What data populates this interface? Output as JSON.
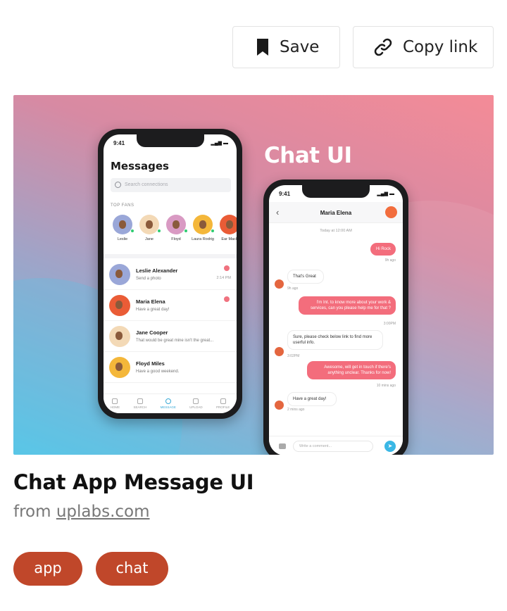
{
  "actions": {
    "save_label": "Save",
    "copy_label": "Copy link"
  },
  "hero": {
    "headline": "Chat UI",
    "messages_screen": {
      "time": "9:41",
      "title": "Messages",
      "search_placeholder": "Search connections",
      "section_label": "TOP FANS",
      "fans": [
        {
          "name": "Leslie",
          "color": "#9aa7d8"
        },
        {
          "name": "Jane",
          "color": "#f3d9b6"
        },
        {
          "name": "Floyd",
          "color": "#d99ac3"
        },
        {
          "name": "Laura Rodrig",
          "color": "#f4b73a"
        },
        {
          "name": "Ear Mack",
          "color": "#ea5c36"
        }
      ],
      "chats": [
        {
          "name": "Leslie Alexander",
          "message": "Send a photo",
          "time": "2:14 PM",
          "color": "#9aa7d8",
          "unread": true
        },
        {
          "name": "Maria Elena",
          "message": "Have a great day!",
          "time": "",
          "color": "#ea5c36",
          "unread": true
        },
        {
          "name": "Jane Cooper",
          "message": "That would be great mine isn't the great...",
          "time": "",
          "color": "#f3d9b6",
          "unread": false
        },
        {
          "name": "Floyd Miles",
          "message": "Have a good weekend.",
          "time": "",
          "color": "#f4b73a",
          "unread": false
        }
      ],
      "tabs": [
        "HOME",
        "SEARCH",
        "MESSAGE",
        "UPLOAD",
        "PROFILE"
      ]
    },
    "conversation_screen": {
      "time": "9:41",
      "contact": "Maria Elena",
      "date_label": "Today at 12:00 AM",
      "messages": [
        {
          "dir": "out",
          "text": "Hi Rock",
          "meta": "9h ago"
        },
        {
          "dir": "in",
          "text": "That's Great",
          "meta": "9h ago"
        },
        {
          "dir": "out",
          "text": "I'm Int. to know more about your work & services, can you please help me for that ?",
          "meta": "3:00PM"
        },
        {
          "dir": "in",
          "text": "Sure, please check below link to find more userful info.",
          "meta": "3:02PM"
        },
        {
          "dir": "out",
          "text": "Awesome, will get in touch if there's anything unclear. Thanks for now!",
          "meta": "10 mins ago"
        },
        {
          "dir": "in",
          "text": "Have a great day!",
          "meta": "2 mins ago"
        }
      ],
      "composer_placeholder": "Write a comment..."
    }
  },
  "pin": {
    "title": "Chat App Message UI",
    "source_prefix": "from",
    "source_domain": "uplabs.com"
  },
  "tags": [
    "app",
    "chat"
  ],
  "colors": {
    "tag_bg": "#c0472a",
    "bubble_out": "#f36d7c",
    "accent_blue": "#3aa9d6"
  }
}
